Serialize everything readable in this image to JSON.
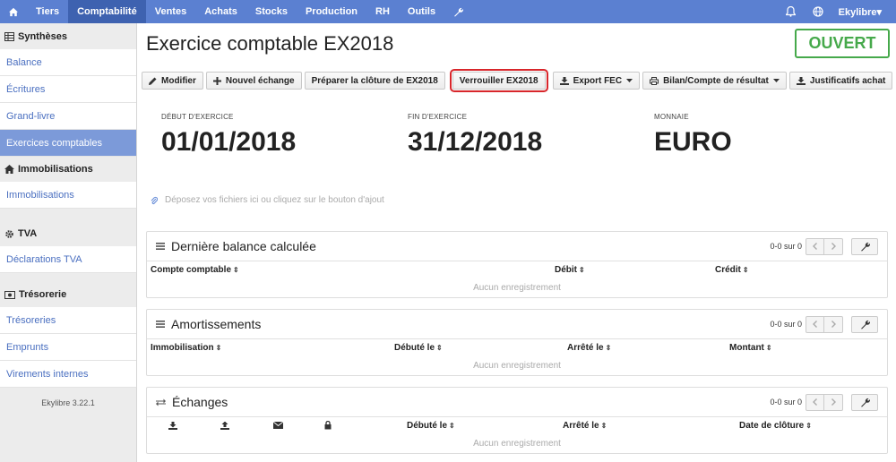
{
  "nav": {
    "items": [
      {
        "label": "Tiers",
        "active": false
      },
      {
        "label": "Comptabilité",
        "active": true
      },
      {
        "label": "Ventes",
        "active": false
      },
      {
        "label": "Achats",
        "active": false
      },
      {
        "label": "Stocks",
        "active": false
      },
      {
        "label": "Production",
        "active": false
      },
      {
        "label": "RH",
        "active": false
      },
      {
        "label": "Outils",
        "active": false
      }
    ],
    "user": "Ekylibre▾"
  },
  "sidebar": {
    "sections": [
      {
        "title": "Synthèses",
        "items": [
          "Balance",
          "Écritures",
          "Grand-livre",
          "Exercices comptables"
        ]
      },
      {
        "title": "Immobilisations",
        "items": [
          "Immobilisations"
        ]
      },
      {
        "title": "TVA",
        "items": [
          "Déclarations TVA"
        ]
      },
      {
        "title": "Trésorerie",
        "items": [
          "Trésoreries",
          "Emprunts",
          "Virements internes"
        ]
      }
    ],
    "active_item": "Exercices comptables",
    "version": "Ekylibre 3.22.1"
  },
  "page": {
    "title": "Exercice comptable EX2018",
    "status": "OUVERT"
  },
  "toolbar": {
    "buttons": [
      {
        "label": "Modifier",
        "icon": "pencil-icon",
        "dropdown": false
      },
      {
        "label": "Nouvel échange",
        "icon": "plus-icon",
        "dropdown": false
      },
      {
        "label": "Préparer la clôture de EX2018",
        "icon": "",
        "dropdown": false
      },
      {
        "label": "Verrouiller EX2018",
        "icon": "",
        "dropdown": false,
        "highlighted": true
      },
      {
        "label": "Export FEC",
        "icon": "download-icon",
        "dropdown": true
      },
      {
        "label": "Bilan/Compte de résultat",
        "icon": "print-icon",
        "dropdown": true
      },
      {
        "label": "Justificatifs achat",
        "icon": "download-icon",
        "dropdown": false
      }
    ]
  },
  "info": {
    "start_label": "DÉBUT D'EXERCICE",
    "start_value": "01/01/2018",
    "end_label": "FIN D'EXERCICE",
    "end_value": "31/12/2018",
    "currency_label": "MONNAIE",
    "currency_value": "EURO"
  },
  "dropzone": "Déposez vos fichiers ici ou cliquez sur le bouton d'ajout",
  "panels": [
    {
      "title": "Dernière balance calculée",
      "icon": "list-icon",
      "pager": "0-0 sur 0",
      "columns": [
        "Compte comptable",
        "Débit",
        "Crédit"
      ],
      "empty": "Aucun enregistrement"
    },
    {
      "title": "Amortissements",
      "icon": "list-icon",
      "pager": "0-0 sur 0",
      "columns": [
        "Immobilisation",
        "Débuté le",
        "Arrêté le",
        "Montant"
      ],
      "empty": "Aucun enregistrement"
    },
    {
      "title": "Échanges",
      "icon": "exchange-icon",
      "pager": "0-0 sur 0",
      "columns": [
        "Débuté le",
        "Arrêté le",
        "Date de clôture"
      ],
      "empty": "Aucun enregistrement"
    }
  ],
  "colors": {
    "nav_bg": "#5b80d1",
    "nav_active": "#3e62b0",
    "sidebar_active": "#7c9ad9",
    "status_green": "#46a94b",
    "highlight_red": "#d8262b"
  }
}
